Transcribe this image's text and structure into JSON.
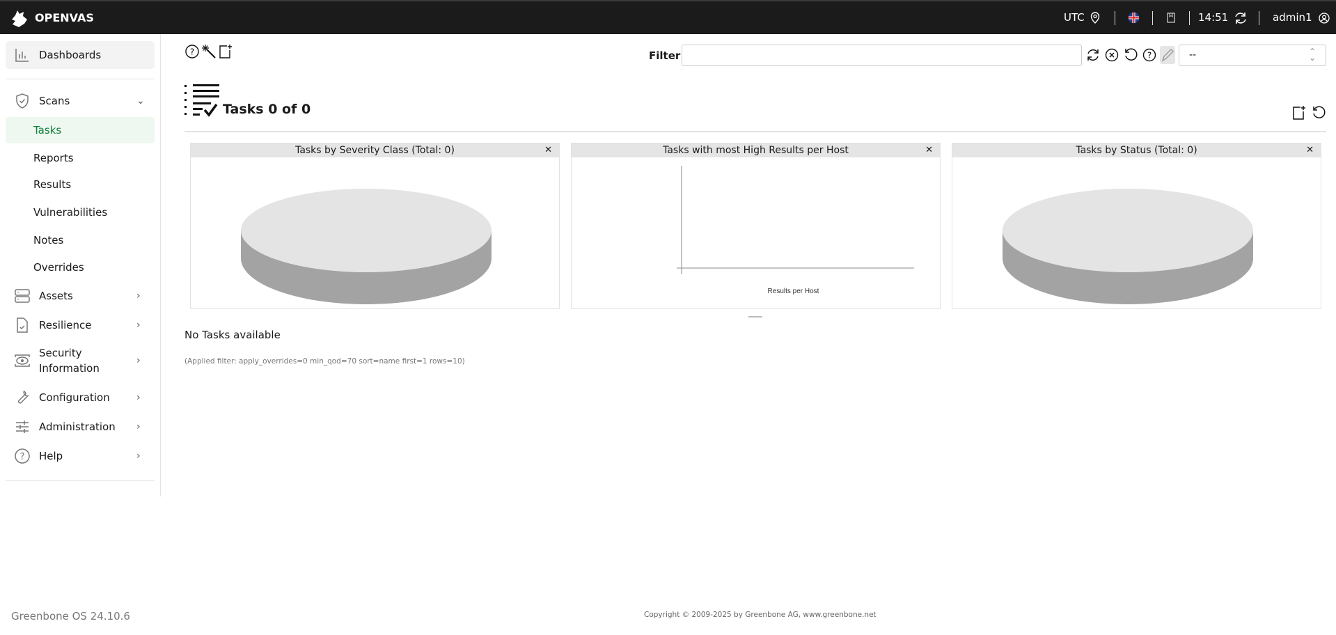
{
  "header": {
    "brand": "OPENVAS",
    "timezone": "UTC",
    "time": "14:51",
    "user": "admin1",
    "language_icon": "uk-flag-icon"
  },
  "sidebar": {
    "dashboards": "Dashboards",
    "scans": "Scans",
    "scans_items": [
      "Tasks",
      "Reports",
      "Results",
      "Vulnerabilities",
      "Notes",
      "Overrides"
    ],
    "active_item": "Tasks",
    "groups": [
      {
        "label": "Assets"
      },
      {
        "label": "Resilience"
      },
      {
        "label": "Security Information"
      },
      {
        "label": "Configuration"
      },
      {
        "label": "Administration"
      },
      {
        "label": "Help"
      }
    ]
  },
  "toolbar": {
    "filter_label": "Filter",
    "filter_value": "",
    "select_value": "--"
  },
  "page": {
    "title": "Tasks 0 of 0",
    "empty": "No Tasks available",
    "applied_filter": "(Applied filter: apply_overrides=0 min_qod=70 sort=name first=1 rows=10)"
  },
  "charts": [
    {
      "title": "Tasks by Severity Class (Total: 0)",
      "type": "pie",
      "values": []
    },
    {
      "title": "Tasks with most High Results per Host",
      "type": "bar",
      "xlabel": "Results per Host",
      "values": []
    },
    {
      "title": "Tasks by Status (Total: 0)",
      "type": "pie",
      "values": []
    }
  ],
  "footer": {
    "version": "Greenbone OS 24.10.6",
    "copyright": "Copyright © 2009-2025 by Greenbone AG, www.greenbone.net"
  },
  "colors": {
    "header_bg": "#1b1b1b",
    "active_green": "#11803b",
    "active_bg": "#eef7f0"
  }
}
